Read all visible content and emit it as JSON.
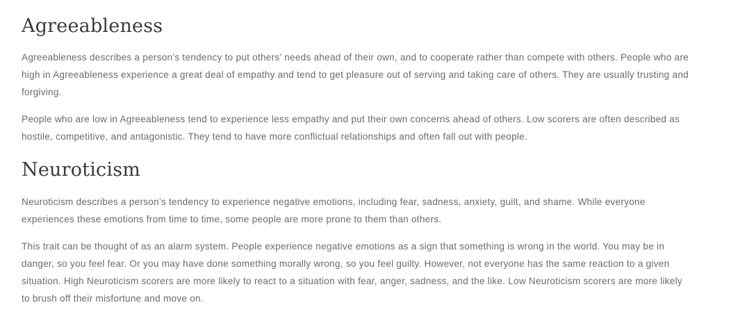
{
  "sections": [
    {
      "heading": "Agreeableness",
      "paragraphs": [
        "Agreeableness describes a person’s tendency to put others’ needs ahead of their own, and to cooperate rather than compete with others. People who are high in Agreeableness experience a great deal of empathy and tend to get pleasure out of serving and taking care of others. They are usually trusting and forgiving.",
        "People who are low in Agreeableness tend to experience less empathy and put their own concerns ahead of others. Low scorers are often described as hostile, competitive, and antagonistic. They tend to have more conflictual relationships and often fall out with people."
      ]
    },
    {
      "heading": "Neuroticism",
      "paragraphs": [
        "Neuroticism describes a person’s tendency to experience negative emotions, including fear, sadness, anxiety, guilt, and shame. While everyone experiences these emotions from time to time, some people are more prone to them than others.",
        "This trait can be thought of as an alarm system. People experience negative emotions as a sign that something is wrong in the world. You may be in danger, so you feel fear. Or you may have done something morally wrong, so you feel guilty. However, not everyone has the same reaction to a given situation. High Neuroticism scorers are more likely to react to a situation with fear, anger, sadness, and the like. Low Neuroticism scorers are more likely to brush off their misfortune and move on."
      ]
    }
  ]
}
